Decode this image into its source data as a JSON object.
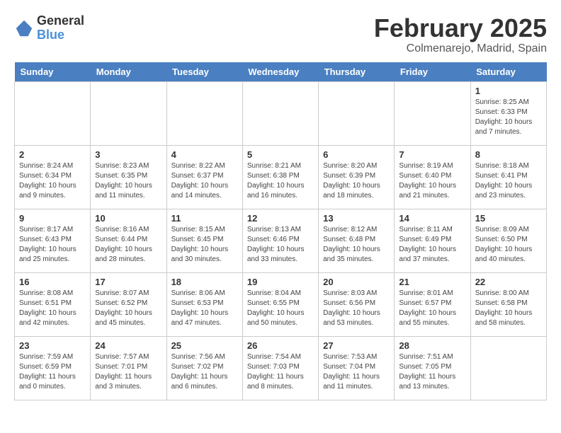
{
  "header": {
    "logo_general": "General",
    "logo_blue": "Blue",
    "month_title": "February 2025",
    "location": "Colmenarejo, Madrid, Spain"
  },
  "days_of_week": [
    "Sunday",
    "Monday",
    "Tuesday",
    "Wednesday",
    "Thursday",
    "Friday",
    "Saturday"
  ],
  "weeks": [
    [
      {
        "day": "",
        "info": ""
      },
      {
        "day": "",
        "info": ""
      },
      {
        "day": "",
        "info": ""
      },
      {
        "day": "",
        "info": ""
      },
      {
        "day": "",
        "info": ""
      },
      {
        "day": "",
        "info": ""
      },
      {
        "day": "1",
        "info": "Sunrise: 8:25 AM\nSunset: 6:33 PM\nDaylight: 10 hours and 7 minutes."
      }
    ],
    [
      {
        "day": "2",
        "info": "Sunrise: 8:24 AM\nSunset: 6:34 PM\nDaylight: 10 hours and 9 minutes."
      },
      {
        "day": "3",
        "info": "Sunrise: 8:23 AM\nSunset: 6:35 PM\nDaylight: 10 hours and 11 minutes."
      },
      {
        "day": "4",
        "info": "Sunrise: 8:22 AM\nSunset: 6:37 PM\nDaylight: 10 hours and 14 minutes."
      },
      {
        "day": "5",
        "info": "Sunrise: 8:21 AM\nSunset: 6:38 PM\nDaylight: 10 hours and 16 minutes."
      },
      {
        "day": "6",
        "info": "Sunrise: 8:20 AM\nSunset: 6:39 PM\nDaylight: 10 hours and 18 minutes."
      },
      {
        "day": "7",
        "info": "Sunrise: 8:19 AM\nSunset: 6:40 PM\nDaylight: 10 hours and 21 minutes."
      },
      {
        "day": "8",
        "info": "Sunrise: 8:18 AM\nSunset: 6:41 PM\nDaylight: 10 hours and 23 minutes."
      }
    ],
    [
      {
        "day": "9",
        "info": "Sunrise: 8:17 AM\nSunset: 6:43 PM\nDaylight: 10 hours and 25 minutes."
      },
      {
        "day": "10",
        "info": "Sunrise: 8:16 AM\nSunset: 6:44 PM\nDaylight: 10 hours and 28 minutes."
      },
      {
        "day": "11",
        "info": "Sunrise: 8:15 AM\nSunset: 6:45 PM\nDaylight: 10 hours and 30 minutes."
      },
      {
        "day": "12",
        "info": "Sunrise: 8:13 AM\nSunset: 6:46 PM\nDaylight: 10 hours and 33 minutes."
      },
      {
        "day": "13",
        "info": "Sunrise: 8:12 AM\nSunset: 6:48 PM\nDaylight: 10 hours and 35 minutes."
      },
      {
        "day": "14",
        "info": "Sunrise: 8:11 AM\nSunset: 6:49 PM\nDaylight: 10 hours and 37 minutes."
      },
      {
        "day": "15",
        "info": "Sunrise: 8:09 AM\nSunset: 6:50 PM\nDaylight: 10 hours and 40 minutes."
      }
    ],
    [
      {
        "day": "16",
        "info": "Sunrise: 8:08 AM\nSunset: 6:51 PM\nDaylight: 10 hours and 42 minutes."
      },
      {
        "day": "17",
        "info": "Sunrise: 8:07 AM\nSunset: 6:52 PM\nDaylight: 10 hours and 45 minutes."
      },
      {
        "day": "18",
        "info": "Sunrise: 8:06 AM\nSunset: 6:53 PM\nDaylight: 10 hours and 47 minutes."
      },
      {
        "day": "19",
        "info": "Sunrise: 8:04 AM\nSunset: 6:55 PM\nDaylight: 10 hours and 50 minutes."
      },
      {
        "day": "20",
        "info": "Sunrise: 8:03 AM\nSunset: 6:56 PM\nDaylight: 10 hours and 53 minutes."
      },
      {
        "day": "21",
        "info": "Sunrise: 8:01 AM\nSunset: 6:57 PM\nDaylight: 10 hours and 55 minutes."
      },
      {
        "day": "22",
        "info": "Sunrise: 8:00 AM\nSunset: 6:58 PM\nDaylight: 10 hours and 58 minutes."
      }
    ],
    [
      {
        "day": "23",
        "info": "Sunrise: 7:59 AM\nSunset: 6:59 PM\nDaylight: 11 hours and 0 minutes."
      },
      {
        "day": "24",
        "info": "Sunrise: 7:57 AM\nSunset: 7:01 PM\nDaylight: 11 hours and 3 minutes."
      },
      {
        "day": "25",
        "info": "Sunrise: 7:56 AM\nSunset: 7:02 PM\nDaylight: 11 hours and 6 minutes."
      },
      {
        "day": "26",
        "info": "Sunrise: 7:54 AM\nSunset: 7:03 PM\nDaylight: 11 hours and 8 minutes."
      },
      {
        "day": "27",
        "info": "Sunrise: 7:53 AM\nSunset: 7:04 PM\nDaylight: 11 hours and 11 minutes."
      },
      {
        "day": "28",
        "info": "Sunrise: 7:51 AM\nSunset: 7:05 PM\nDaylight: 11 hours and 13 minutes."
      },
      {
        "day": "",
        "info": ""
      }
    ]
  ]
}
